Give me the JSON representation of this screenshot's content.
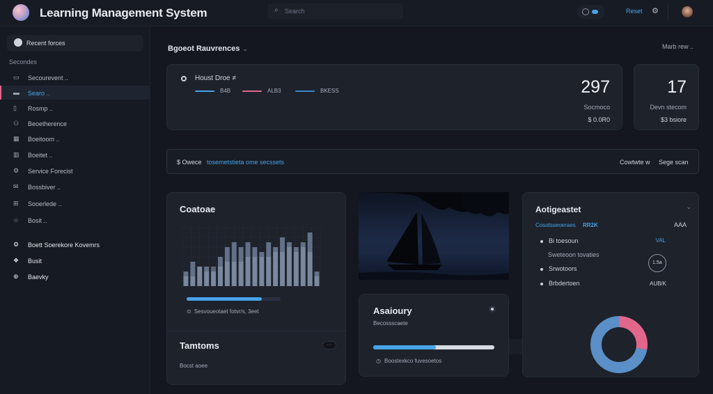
{
  "header": {
    "app_title": "Learning Management System",
    "search_placeholder": "Search",
    "link_label": "Reset",
    "icons": [
      "logo",
      "search-icon",
      "toggle-icon",
      "bell-icon",
      "avatar"
    ]
  },
  "sidebar": {
    "top_label": "Recent forces",
    "section_label": "Secondes",
    "items": [
      {
        "label": "Secourevent ..",
        "icon": "document-icon"
      },
      {
        "label": "Searo ..",
        "icon": "folder-icon",
        "active": true
      },
      {
        "label": "Rosmp ..",
        "icon": "book-icon"
      },
      {
        "label": "Beoetherence",
        "icon": "users-icon"
      },
      {
        "label": "Boeitoom ..",
        "icon": "calendar-icon"
      },
      {
        "label": "Boeitet ..",
        "icon": "chart-icon"
      },
      {
        "label": "Service Forecist",
        "icon": "gear-icon"
      },
      {
        "label": "Bossbiver ..",
        "icon": "message-icon"
      },
      {
        "label": "Sooerlede ..",
        "icon": "grid-icon"
      },
      {
        "label": "Bosit ..",
        "icon": "star-icon"
      }
    ],
    "footer_items": [
      {
        "label": "Boett Soerekore Kovemrs",
        "icon": "settings-icon"
      },
      {
        "label": "Busit",
        "icon": "bookmark-icon"
      },
      {
        "label": "Baevky",
        "icon": "help-icon"
      }
    ]
  },
  "main": {
    "breadcrumb": "Bgoeot Rauvrences",
    "filter_label": "Marb rew ..",
    "summary": {
      "title": "Houst Droe ≠",
      "legend": [
        {
          "label": "B4B",
          "color": "#47a3e8"
        },
        {
          "label": "ALB3",
          "color": "#e0668b"
        },
        {
          "label": "BKESS",
          "color": "#3f86c9"
        }
      ],
      "big_value": "297",
      "sub_label": "Socmoco",
      "sub_value": "$ 0.0R0"
    },
    "stat": {
      "big_value": "17",
      "sub_label": "Devn stecom",
      "sub_value": "$3 bsiore"
    },
    "banner": {
      "prefix": "$ Owece",
      "link": "tosemetstieta ome secssets",
      "right1": "Cowtwte w",
      "right2": "Sege scan"
    },
    "chart_card": {
      "title": "Coatoae",
      "progress": 0.8,
      "note": "Sesvoueotaet fotvr/s, 3eet",
      "title2": "Tamtoms",
      "badge": "···",
      "sub": "Bocst aoee"
    },
    "activity": {
      "title": "Asaioury",
      "sub": "Becossscaete",
      "progress": 0.52,
      "note": "Boostexkco fuvesoetos"
    },
    "side": {
      "title": "Aotigeastet",
      "tag1": "Cosotsseoeraes",
      "tag2": "RR2K",
      "tag_right": "AAA",
      "items": [
        {
          "label": "Bi toesoun",
          "value": "VAL"
        },
        {
          "label": "Sweteoon tovaties",
          "value": ""
        },
        {
          "label": "Srwotoors",
          "value": ""
        },
        {
          "label": "Brbdertoen",
          "value": "AUB/K"
        }
      ],
      "circle_label": "1.5a",
      "donut": {
        "segments": [
          0.28,
          0.72
        ],
        "colors": [
          "#e0668b",
          "#5a8fc7"
        ]
      }
    }
  },
  "chart_data": {
    "type": "bar",
    "series": [
      {
        "values": [
          3,
          5,
          4,
          4,
          3,
          6,
          8,
          9,
          8,
          9,
          8,
          7,
          9,
          8,
          10,
          9,
          8,
          9,
          11,
          3
        ]
      },
      {
        "values": [
          2,
          2,
          4,
          3,
          4,
          4,
          5,
          5,
          5,
          6,
          6,
          6,
          6,
          7,
          7,
          8,
          7,
          8,
          7,
          2
        ]
      }
    ],
    "ylim": [
      0,
      12
    ],
    "grid": true
  }
}
